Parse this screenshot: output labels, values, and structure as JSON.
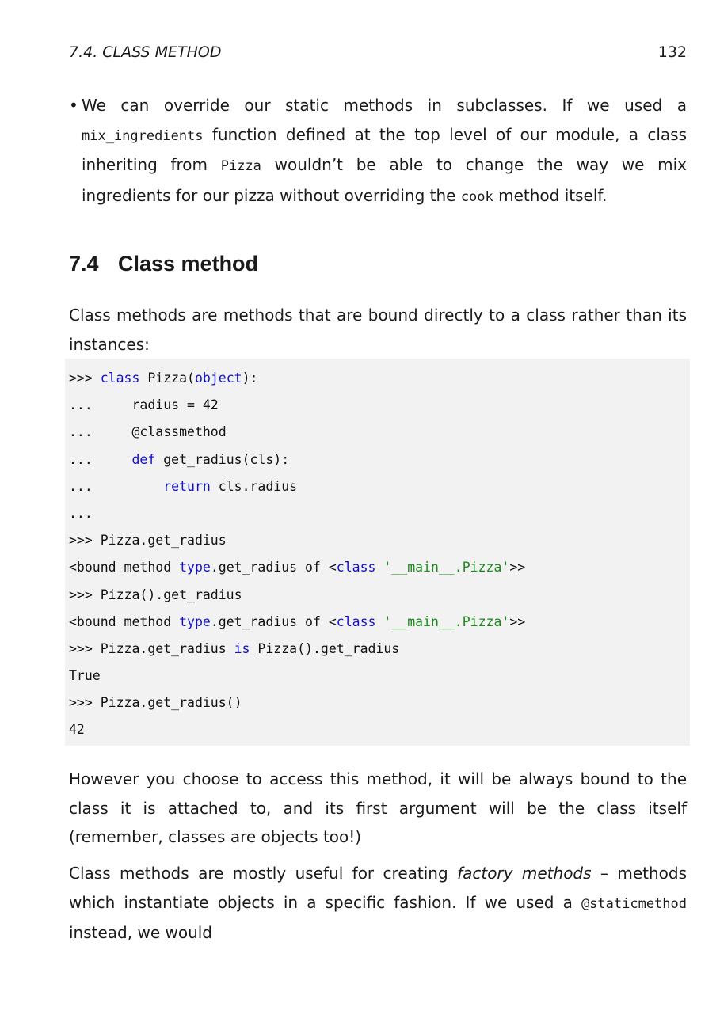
{
  "header": {
    "section_ref": "7.4.  CLASS METHOD",
    "page_number": "132"
  },
  "bullet": {
    "marker": "•",
    "text_1": "We can override our static methods in subclasses.  If we used a ",
    "code_1": "mix_ingredients",
    "text_2": " function defined at the top level of our module, a class inheriting from ",
    "code_2": "Pizza",
    "text_3": " wouldn’t be able to change the way we mix ingredients for our pizza without overriding the ",
    "code_3": "cook",
    "text_4": " method itself."
  },
  "section": {
    "number": "7.4",
    "title": "Class method"
  },
  "intro": "Class methods are methods that are bound directly to a class rather than its instances:",
  "code": {
    "l1_prompt": ">>> ",
    "l1_kw": "class",
    "l1_a": " Pizza(",
    "l1_b": "object",
    "l1_c": "):",
    "l2": "...     radius = 42",
    "l3": "...     @classmethod",
    "l4_prompt": "...     ",
    "l4_kw": "def",
    "l4_rest": " get_radius(cls):",
    "l5_prompt": "...         ",
    "l5_kw": "return",
    "l5_rest": " cls.radius",
    "l6": "...",
    "l7": ">>> Pizza.get_radius",
    "l8_a": "<bound method ",
    "l8_b": "type",
    "l8_c": ".get_radius of <",
    "l8_d": "class",
    "l8_e": " ",
    "l8_f": "'__main__.Pizza'",
    "l8_g": ">>",
    "l9": ">>> Pizza().get_radius",
    "l10_a": "<bound method ",
    "l10_b": "type",
    "l10_c": ".get_radius of <",
    "l10_d": "class",
    "l10_e": " ",
    "l10_f": "'__main__.Pizza'",
    "l10_g": ">>",
    "l11_a": ">>> Pizza.get_radius ",
    "l11_b": "is",
    "l11_c": " Pizza().get_radius",
    "l12": "True",
    "l13": ">>> Pizza.get_radius()",
    "l14": "42"
  },
  "para2": "However you choose to access this method, it will be always bound to the class it is attached to, and its first argument will be the class itself (remember, classes are objects too!)",
  "para3": {
    "text_1": "Class methods are mostly useful for creating ",
    "em": "factory methods",
    "text_2": " – methods which instantiate objects in a specific fashion.  If we used a ",
    "code": "@staticmethod",
    "text_3": " instead, we would"
  }
}
